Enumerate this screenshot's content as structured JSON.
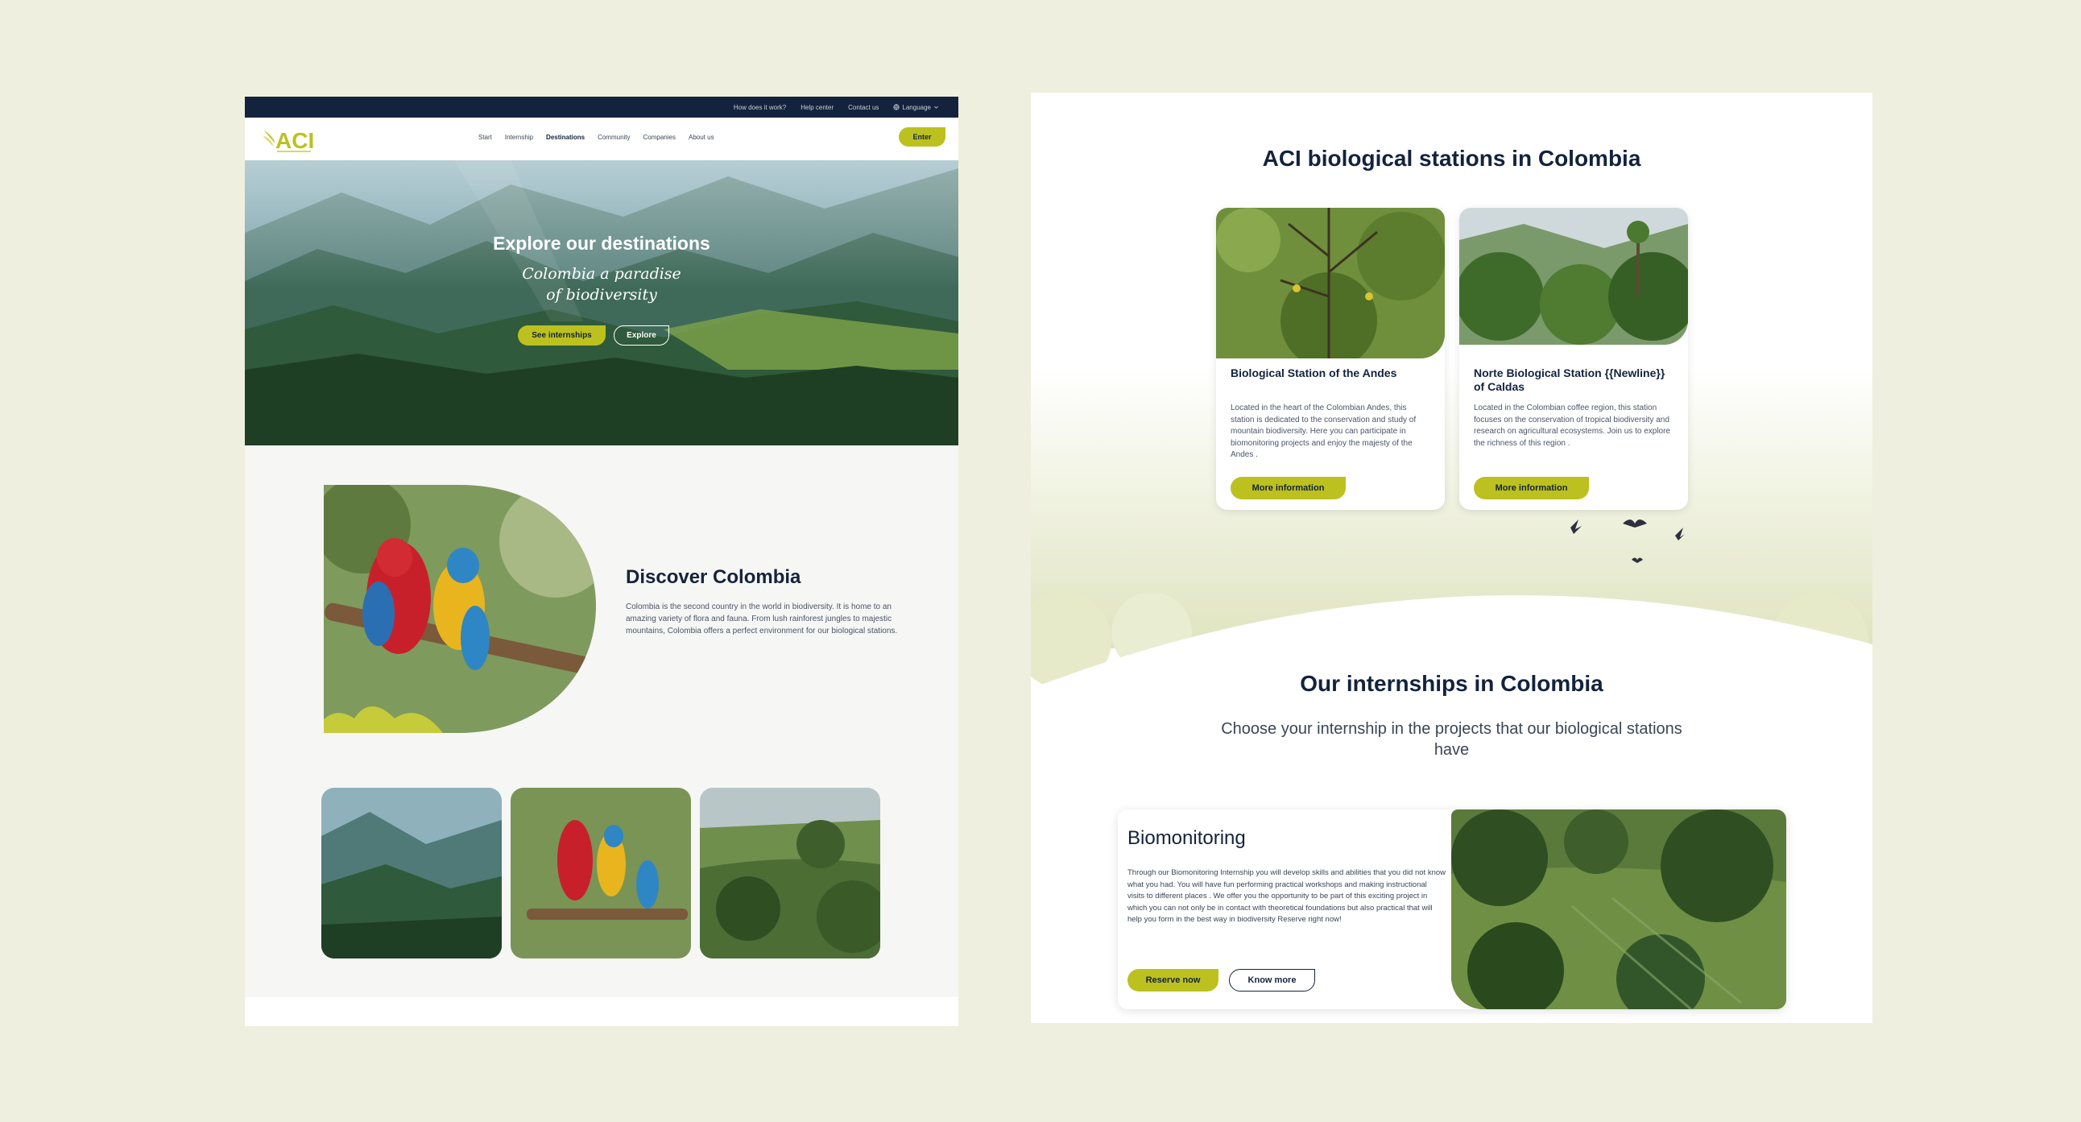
{
  "left_page": {
    "topbar": {
      "how": "How does it work?",
      "help": "Help center",
      "contact": "Contact us",
      "language": "Language"
    },
    "logo": {
      "text": "ACI"
    },
    "nav": {
      "items": [
        "Start",
        "Internship",
        "Destinations",
        "Community",
        "Companies",
        "About us"
      ],
      "active": "Destinations",
      "enter_label": "Enter"
    },
    "hero": {
      "title": "Explore our destinations",
      "script_line1": "Colombia a paradise",
      "script_line2": "of biodiversity",
      "see_internships_label": "See internships",
      "explore_label": "Explore"
    },
    "discover": {
      "title": "Discover Colombia",
      "text": "Colombia is the second country in the world in biodiversity. It is home to an amazing variety of flora and fauna. From lush rainforest jungles to majestic mountains, Colombia offers a perfect environment for our biological stations."
    }
  },
  "right_page": {
    "stations": {
      "title": "ACI biological stations in Colombia",
      "cards": [
        {
          "title": "Biological Station of the Andes",
          "text": "Located in the heart of the Colombian Andes, this station is dedicated to the conservation and study of mountain biodiversity. Here you can participate in biomonitoring projects and enjoy the majesty of the Andes .",
          "button": "More information"
        },
        {
          "title": "Norte Biological Station {{Newline}} of Caldas",
          "text": "Located in the Colombian coffee region, this station focuses on the conservation of tropical biodiversity and research on agricultural ecosystems. Join us to explore the richness of this region .",
          "button": "More information"
        }
      ]
    },
    "internships": {
      "title": "Our internships in Colombia",
      "subtitle": "Choose your internship in the projects that our biological stations have",
      "card": {
        "title": "Biomonitoring",
        "text": "Through our Biomonitoring Internship you will develop skills and abilities that you did not know what you had. You will have fun performing practical workshops and making instructional visits to different places . We offer you the opportunity to be part of this exciting project in which you can not only be in contact with theoretical foundations but also practical that will help you form in the best way in biodiversity Reserve right now!",
        "reserve_label": "Reserve now",
        "know_label": "Know more"
      }
    }
  },
  "colors": {
    "background": "#eeefde",
    "navy": "#13233d",
    "accent": "#bcc11f",
    "panel_bg": "#f6f6f5"
  },
  "icons": [
    "globe-icon",
    "chevron-down-icon",
    "bird-icon"
  ]
}
